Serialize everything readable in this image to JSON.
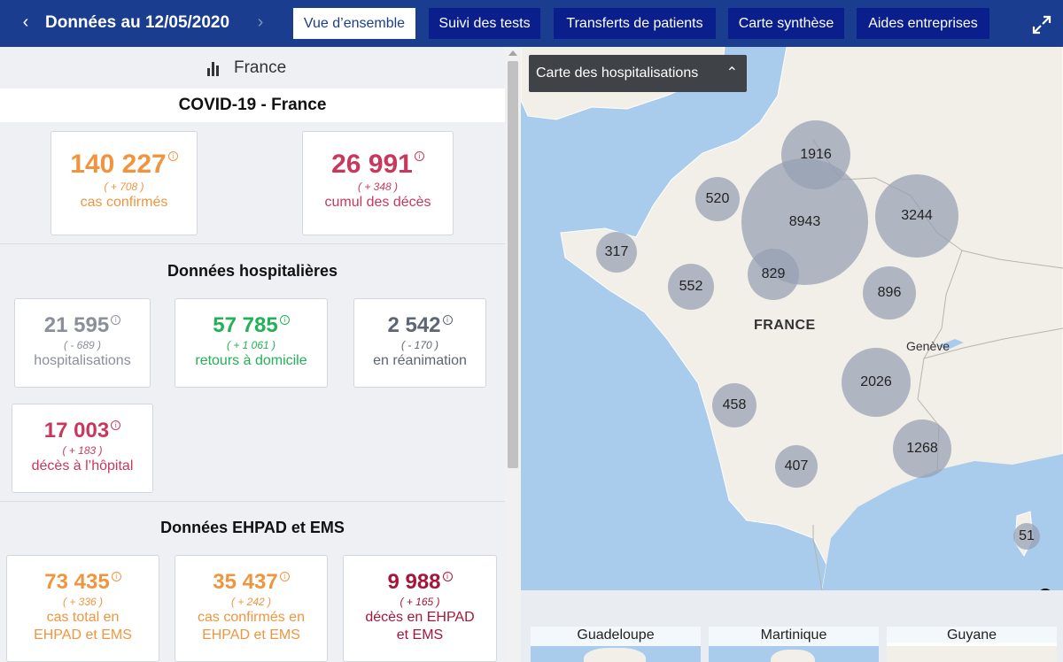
{
  "header": {
    "prev_icon": "chevron-left",
    "next_icon": "chevron-right",
    "title": "Données au 12/05/2020",
    "tabs": [
      {
        "label": "Vue d’ensemble",
        "active": true
      },
      {
        "label": "Suivi des tests",
        "active": false
      },
      {
        "label": "Transferts de patients",
        "active": false
      },
      {
        "label": "Carte synthèse",
        "active": false
      },
      {
        "label": "Aides entreprises",
        "active": false
      }
    ],
    "expand_icon": "expand-arrows"
  },
  "panel": {
    "icon": "bar-chart",
    "country": "France",
    "main_title": "COVID-19 - France",
    "top_cards": [
      {
        "value": "140 227",
        "delta": "( + 708 )",
        "label": "cas confirmés",
        "color": "#f0953e"
      },
      {
        "value": "26 991",
        "delta": "( + 348 )",
        "label": "cumul des décès",
        "color": "#c8385c"
      }
    ],
    "hospital_title": "Données hospitalières",
    "hospital_cards": [
      {
        "value": "21 595",
        "delta": "( - 689 )",
        "label": "hospitalisations",
        "color": "#8a8f9a"
      },
      {
        "value": "57 785",
        "delta": "( + 1 061 )",
        "label": "retours à domicile",
        "color": "#22b256"
      },
      {
        "value": "2 542",
        "delta": "( - 170 )",
        "label": "en réanimation",
        "color": "#5e6574"
      },
      {
        "value": "17 003",
        "delta": "( + 183 )",
        "label": "décès à l’hôpital",
        "color": "#c8385c"
      }
    ],
    "ehpad_title": "Données EHPAD et EMS",
    "ehpad_cards": [
      {
        "value": "73 435",
        "delta": "( + 336 )",
        "label_1": "cas total en",
        "label_2": "EHPAD et EMS",
        "color": "#f0953e"
      },
      {
        "value": "35 437",
        "delta": "( + 242 )",
        "label_1": "cas confirmés en",
        "label_2": "EHPAD et EMS",
        "color": "#f0953e"
      },
      {
        "value": "9 988",
        "delta": "( + 165 )",
        "label_1": "décès en EHPAD",
        "label_2": "et EMS",
        "color": "#a4173b"
      }
    ],
    "info_glyph": "i"
  },
  "map": {
    "toggle_label": "Carte des hospitalisations",
    "country_label": "FRANCE",
    "city_label": "Genève",
    "bubbles": [
      "1916",
      "520",
      "8943",
      "3244",
      "317",
      "552",
      "829",
      "896",
      "2026",
      "458",
      "1268",
      "407",
      "51"
    ],
    "info_glyph": "i",
    "insets": [
      "Guadeloupe",
      "Martinique",
      "Guyane"
    ]
  }
}
